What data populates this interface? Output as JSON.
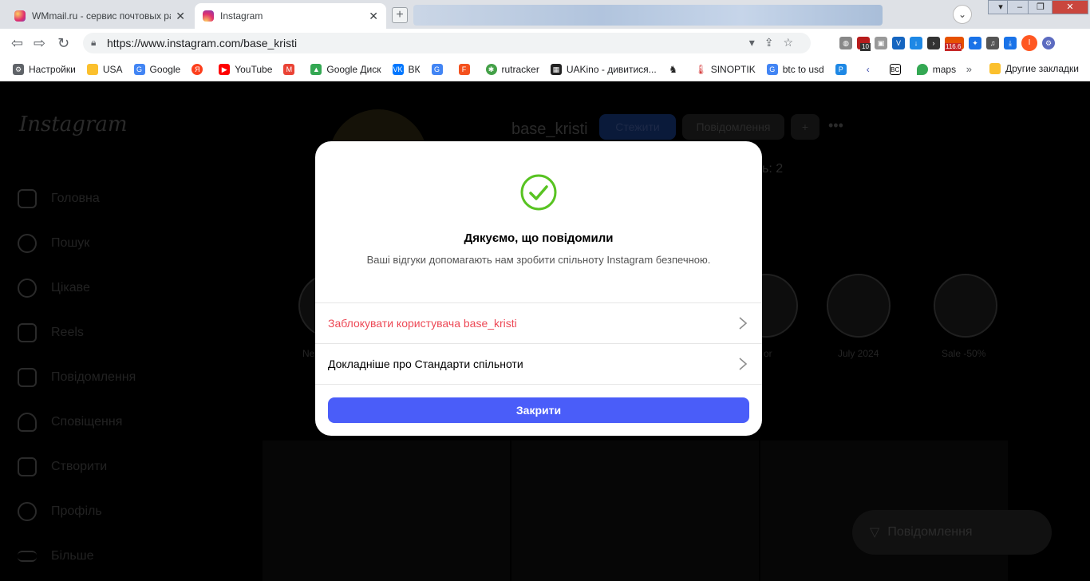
{
  "browser": {
    "tabs": [
      {
        "title": "WMmail.ru - сервис почтовых рас",
        "active": false
      },
      {
        "title": "Instagram",
        "active": true
      }
    ],
    "url": "https://www.instagram.com/base_kristi",
    "extension_badges": {
      "shield": "10",
      "counter": "116.6"
    },
    "profile_initial": "I",
    "bookmarks": [
      {
        "label": "Настройки",
        "icon": "gear-icon"
      },
      {
        "label": "USA",
        "icon": "folder-icon"
      },
      {
        "label": "Google",
        "icon": "google-icon"
      },
      {
        "label": "",
        "icon": "yandex-icon"
      },
      {
        "label": "YouTube",
        "icon": "youtube-icon"
      },
      {
        "label": "",
        "icon": "gmail-icon"
      },
      {
        "label": "Google Диск",
        "icon": "drive-icon"
      },
      {
        "label": "ВК",
        "icon": "vk-icon"
      },
      {
        "label": "",
        "icon": "translate-icon"
      },
      {
        "label": "",
        "icon": "f-icon"
      },
      {
        "label": "rutracker",
        "icon": "rutracker-icon"
      },
      {
        "label": "UAKino - дивитися...",
        "icon": "uakino-icon"
      },
      {
        "label": "",
        "icon": "chess-icon"
      },
      {
        "label": "SINOPTIK",
        "icon": "thermometer-icon"
      },
      {
        "label": "btc to usd",
        "icon": "google-icon"
      },
      {
        "label": "",
        "icon": "p-icon"
      },
      {
        "label": "",
        "icon": "arrow-icon"
      },
      {
        "label": "",
        "icon": "bc-icon"
      },
      {
        "label": "maps",
        "icon": "maps-icon"
      }
    ],
    "bookmarks_more": "»",
    "other_bookmarks": "Другие закладки"
  },
  "instagram": {
    "logo": "Instagram",
    "nav": [
      "Головна",
      "Пошук",
      "Цікаве",
      "Reels",
      "Повідомлення",
      "Сповіщення",
      "Створити",
      "Профіль",
      "Більше"
    ],
    "profile_name": "base_kristi",
    "follow_button": "Стежити",
    "message_button": "Повідомлення",
    "stats_fragment": "ь: 2",
    "highlights": [
      "Ne",
      "or",
      "July 2024",
      "Sale -50%"
    ],
    "messages_pill": "Повідомлення"
  },
  "modal": {
    "title": "Дякуємо, що повідомили",
    "subtitle": "Ваші відгуки допомагають нам зробити спільноту Instagram безпечною.",
    "block_option": "Заблокувати користувача base_kristi",
    "standards_option": "Докладніше про Стандарти спільноти",
    "close_button": "Закрити",
    "colors": {
      "check": "#58c322",
      "danger": "#ed4956",
      "primary": "#4a5df9"
    }
  }
}
